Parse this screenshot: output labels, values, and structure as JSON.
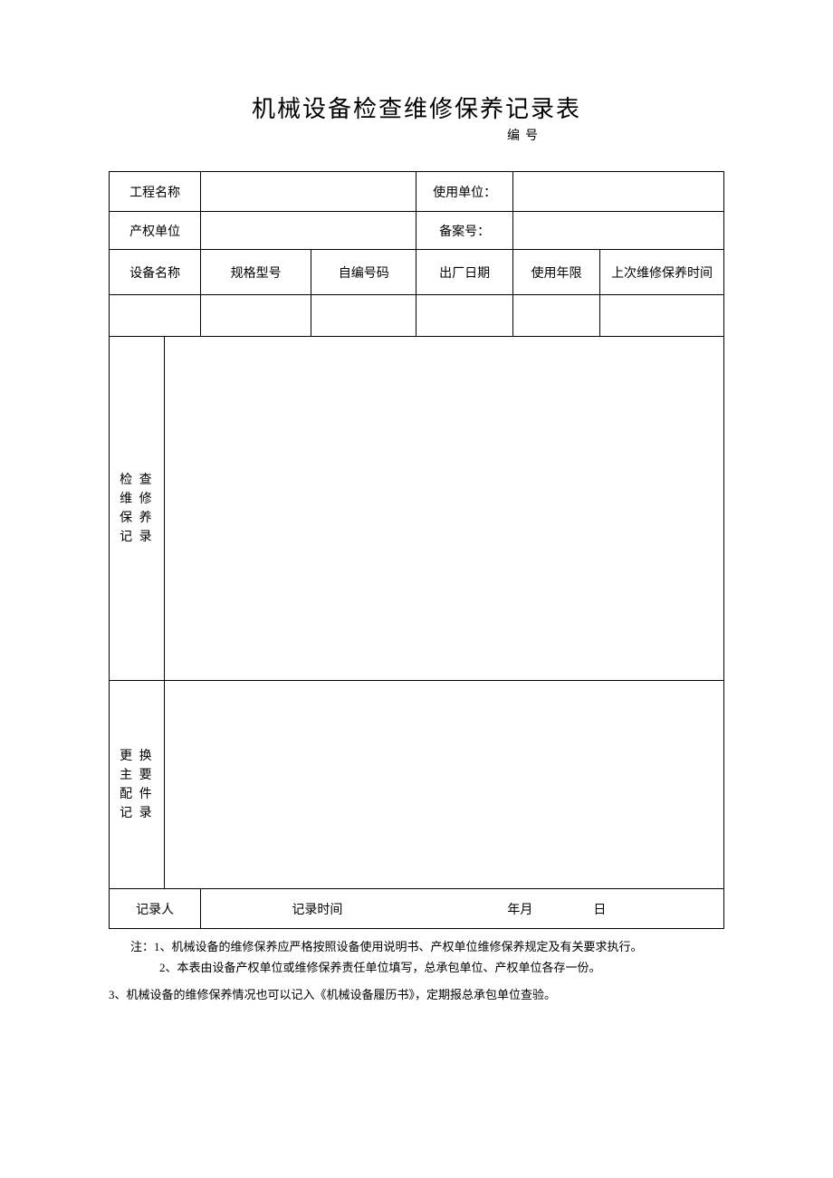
{
  "title": "机械设备检查维修保养记录表",
  "subtitle": "编号",
  "table": {
    "row1": {
      "label1": "工程名称",
      "label2": "使用单位："
    },
    "row2": {
      "label1": "产权单位",
      "label2": "备案号："
    },
    "headers": {
      "h1": "设备名称",
      "h2": "规格型号",
      "h3": "自编号码",
      "h4": "出厂日期",
      "h5": "使用年限",
      "h6": "上次维修保养时间"
    },
    "section1": {
      "l1": "检 查",
      "l2": "维 修",
      "l3": "保 养",
      "l4": "记 录"
    },
    "section2": {
      "l1": "更 换",
      "l2": "主 要",
      "l3": "配 件",
      "l4": "记 录"
    },
    "footer": {
      "recorder": "记录人",
      "time_label": "记录时间",
      "year_month": "年月",
      "day": "日"
    }
  },
  "notes": {
    "n1": "注：1、机械设备的维修保养应严格按照设备使用说明书、产权单位维修保养规定及有关要求执行。",
    "n2": "2、本表由设备产权单位或维修保养责任单位填写，总承包单位、产权单位各存一份。",
    "n3": "3、机械设备的维修保养情况也可以记入《机械设备履历书》，定期报总承包单位查验。"
  }
}
